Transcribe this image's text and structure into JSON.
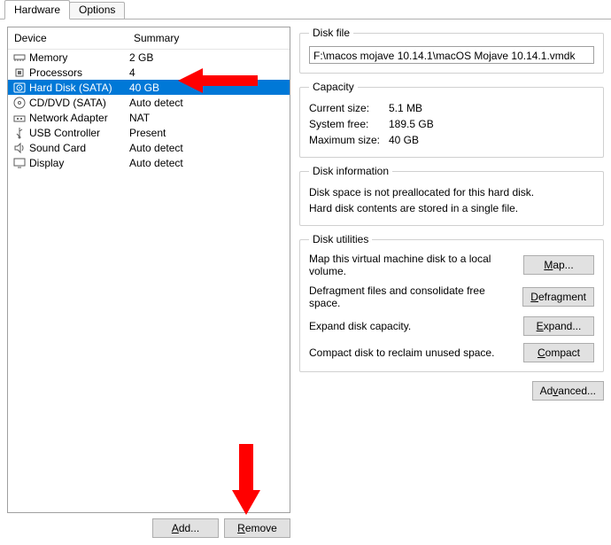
{
  "tabs": {
    "hardware": "Hardware",
    "options": "Options"
  },
  "list": {
    "headers": {
      "device": "Device",
      "summary": "Summary"
    },
    "rows": [
      {
        "name": "Memory",
        "summary": "2 GB",
        "icon": "memory"
      },
      {
        "name": "Processors",
        "summary": "4",
        "icon": "cpu"
      },
      {
        "name": "Hard Disk (SATA)",
        "summary": "40 GB",
        "icon": "hdd",
        "selected": true
      },
      {
        "name": "CD/DVD (SATA)",
        "summary": "Auto detect",
        "icon": "cd"
      },
      {
        "name": "Network Adapter",
        "summary": "NAT",
        "icon": "net"
      },
      {
        "name": "USB Controller",
        "summary": "Present",
        "icon": "usb"
      },
      {
        "name": "Sound Card",
        "summary": "Auto detect",
        "icon": "sound"
      },
      {
        "name": "Display",
        "summary": "Auto detect",
        "icon": "display"
      }
    ]
  },
  "buttons": {
    "add_pre": "",
    "add_m": "A",
    "add_post": "dd...",
    "remove_pre": "",
    "remove_m": "R",
    "remove_post": "emove",
    "map_pre": "",
    "map_m": "M",
    "map_post": "ap...",
    "defrag_pre": "",
    "defrag_m": "D",
    "defrag_post": "efragment",
    "expand_pre": "",
    "expand_m": "E",
    "expand_post": "xpand...",
    "compact_pre": "",
    "compact_m": "C",
    "compact_post": "ompact",
    "advanced_pre": "Ad",
    "advanced_m": "v",
    "advanced_post": "anced..."
  },
  "groups": {
    "diskfile": {
      "legend": "Disk file",
      "path": "F:\\macos mojave 10.14.1\\macOS Mojave 10.14.1.vmdk"
    },
    "capacity": {
      "legend": "Capacity",
      "current_lbl": "Current size:",
      "current_val": "5.1 MB",
      "sysfree_lbl": "System free:",
      "sysfree_val": "189.5 GB",
      "max_lbl": "Maximum size:",
      "max_val": "40 GB"
    },
    "diskinfo": {
      "legend": "Disk information",
      "line1": "Disk space is not preallocated for this hard disk.",
      "line2": "Hard disk contents are stored in a single file."
    },
    "utilities": {
      "legend": "Disk utilities",
      "map_txt": "Map this virtual machine disk to a local volume.",
      "defrag_txt": "Defragment files and consolidate free space.",
      "expand_txt": "Expand disk capacity.",
      "compact_txt": "Compact disk to reclaim unused space."
    }
  }
}
